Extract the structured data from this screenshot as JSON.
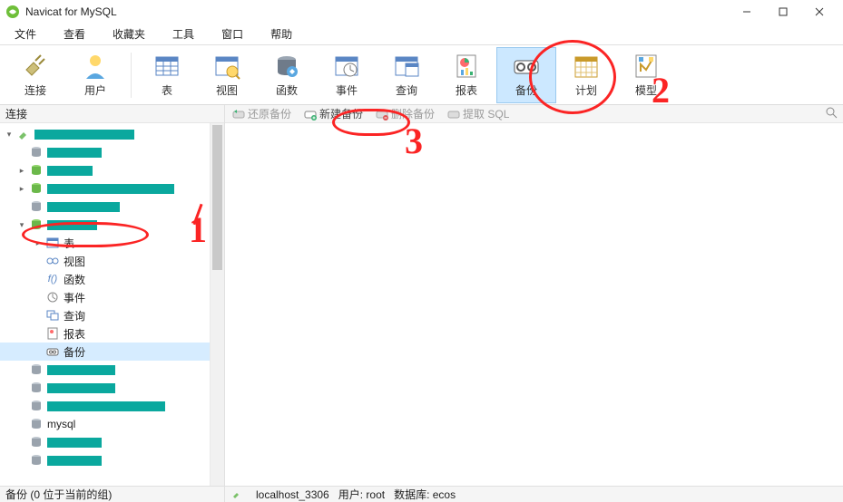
{
  "app": {
    "title": "Navicat for MySQL"
  },
  "menu": [
    "文件",
    "查看",
    "收藏夹",
    "工具",
    "窗口",
    "帮助"
  ],
  "toolbar": [
    {
      "key": "connect",
      "label": "连接"
    },
    {
      "key": "user",
      "label": "用户"
    },
    {
      "key": "table",
      "label": "表"
    },
    {
      "key": "view",
      "label": "视图"
    },
    {
      "key": "function",
      "label": "函数"
    },
    {
      "key": "event",
      "label": "事件"
    },
    {
      "key": "query",
      "label": "查询"
    },
    {
      "key": "report",
      "label": "报表"
    },
    {
      "key": "backup",
      "label": "备份",
      "selected": true
    },
    {
      "key": "schedule",
      "label": "计划"
    },
    {
      "key": "model",
      "label": "模型"
    }
  ],
  "side_header": "连接",
  "subtoolbar": {
    "restore": "还原备份",
    "new": "新建备份",
    "delete": "删除备份",
    "extract": "提取 SQL"
  },
  "tree": {
    "sub": {
      "table": "表",
      "view": "视图",
      "function": "函数",
      "event": "事件",
      "query": "查询",
      "report": "报表",
      "backup": "备份"
    },
    "mysql": "mysql"
  },
  "status": {
    "left": "备份 (0 位于当前的组)",
    "host": "localhost_3306",
    "user": "用户: root",
    "db": "数据库: ecos"
  },
  "annotations": {
    "n1": "1",
    "n2": "2",
    "n3": "3"
  }
}
